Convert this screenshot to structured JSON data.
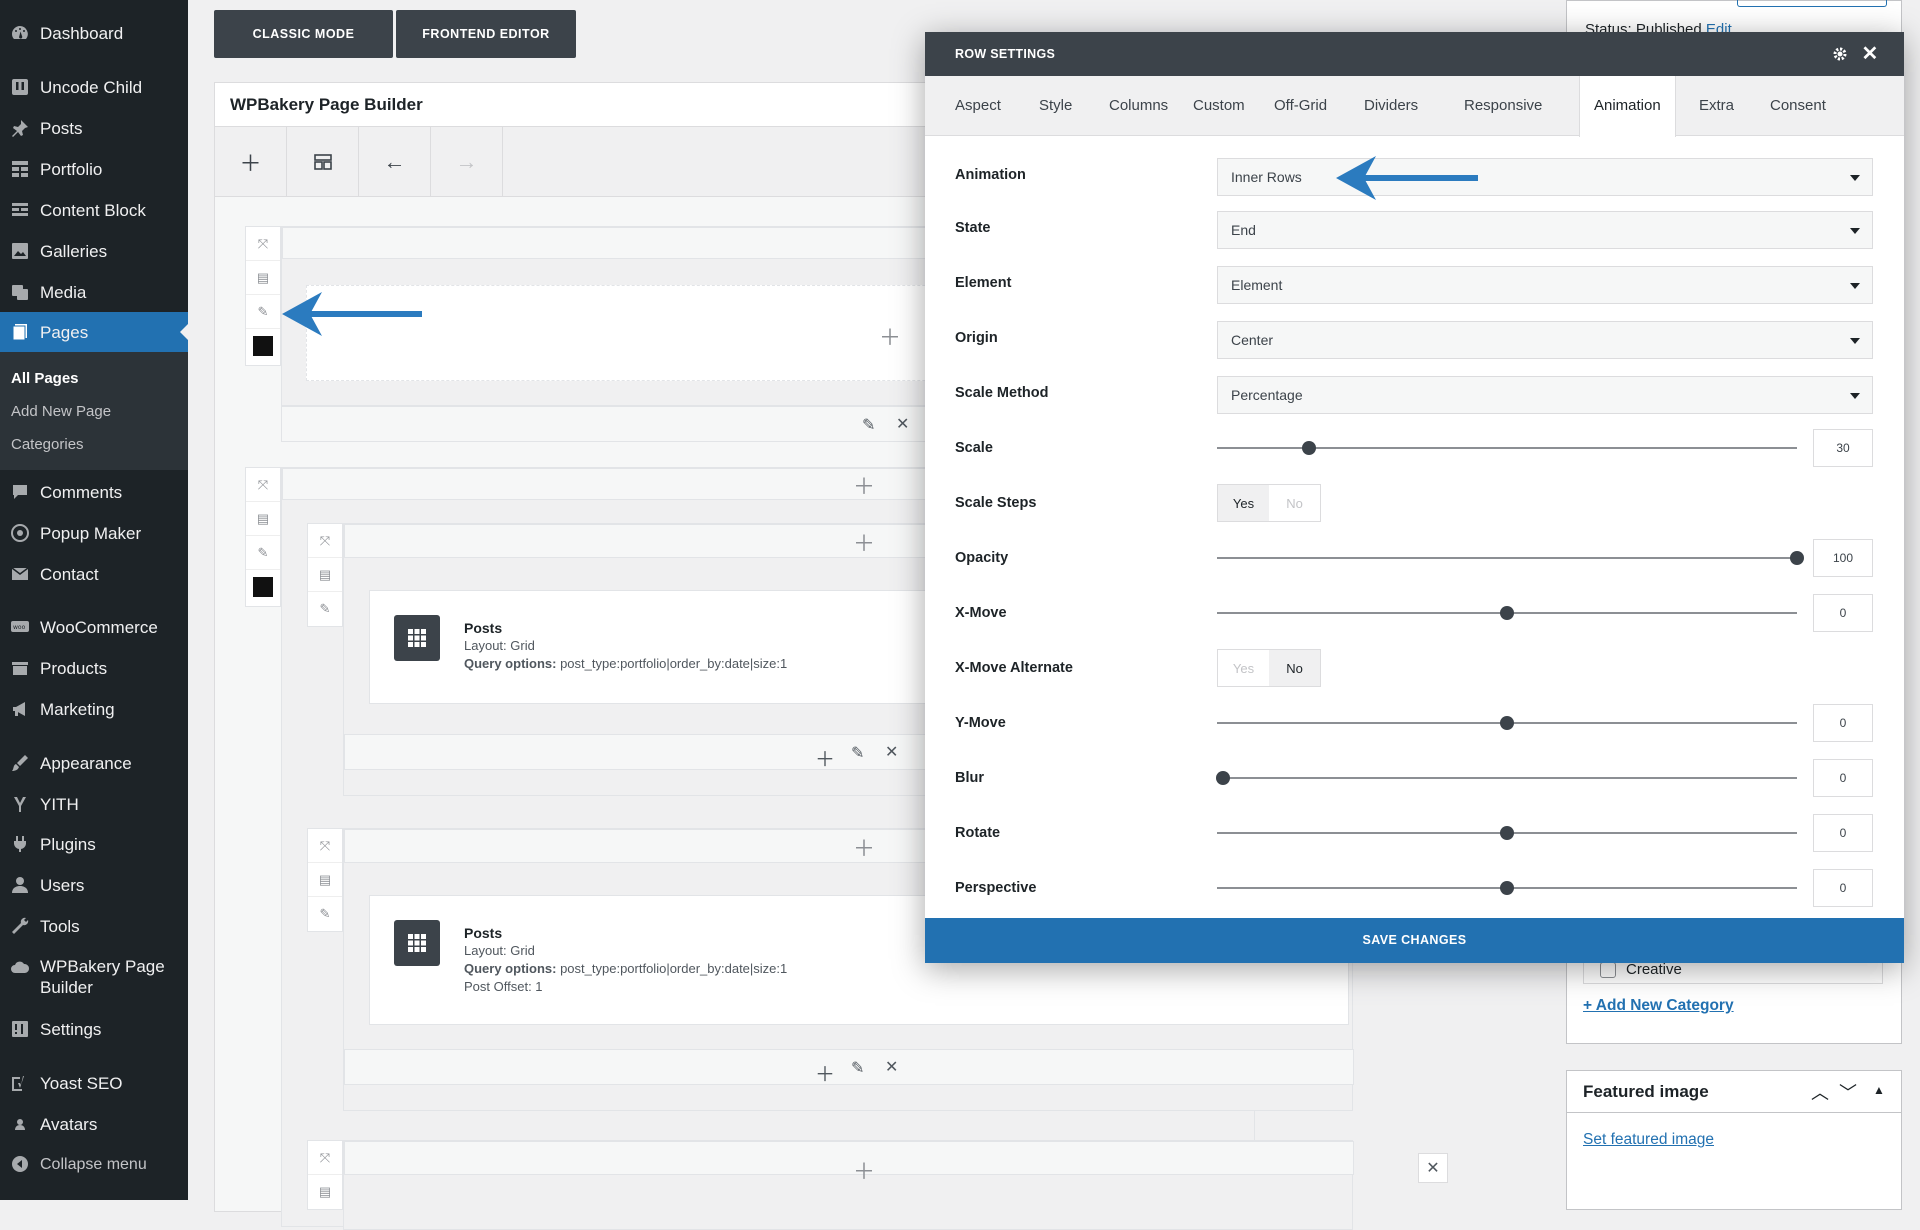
{
  "sidebar": {
    "items": [
      {
        "label": "Dashboard",
        "icon": "dashboard-icon"
      },
      {
        "label": "Uncode Child",
        "icon": "uncode-icon"
      },
      {
        "label": "Posts",
        "icon": "pin-icon"
      },
      {
        "label": "Portfolio",
        "icon": "portfolio-icon"
      },
      {
        "label": "Content Block",
        "icon": "content-block-icon"
      },
      {
        "label": "Galleries",
        "icon": "galleries-icon"
      },
      {
        "label": "Media",
        "icon": "media-icon"
      },
      {
        "label": "Pages",
        "icon": "pages-icon",
        "active": true
      },
      {
        "label": "Comments",
        "icon": "comments-icon"
      },
      {
        "label": "Popup Maker",
        "icon": "popup-icon"
      },
      {
        "label": "Contact",
        "icon": "mail-icon"
      },
      {
        "label": "WooCommerce",
        "icon": "woo-icon"
      },
      {
        "label": "Products",
        "icon": "products-icon"
      },
      {
        "label": "Marketing",
        "icon": "megaphone-icon"
      },
      {
        "label": "Appearance",
        "icon": "brush-icon"
      },
      {
        "label": "YITH",
        "icon": "yith-icon"
      },
      {
        "label": "Plugins",
        "icon": "plug-icon"
      },
      {
        "label": "Users",
        "icon": "user-icon"
      },
      {
        "label": "Tools",
        "icon": "wrench-icon"
      },
      {
        "label": "WPBakery Page Builder",
        "icon": "cloud-icon"
      },
      {
        "label": "Settings",
        "icon": "settings-icon"
      },
      {
        "label": "Yoast SEO",
        "icon": "yoast-icon"
      },
      {
        "label": "Avatars",
        "icon": "avatar-icon"
      },
      {
        "label": "Collapse menu",
        "icon": "collapse-icon"
      }
    ],
    "submenu": [
      "All Pages",
      "Add New Page",
      "Categories"
    ]
  },
  "editor": {
    "classic_mode": "CLASSIC MODE",
    "frontend_editor": "FRONTEND EDITOR",
    "builder_title": "WPBakery Page Builder",
    "elements": [
      {
        "title": "Posts",
        "layout_label": "Layout:",
        "layout": "Grid",
        "query_label": "Query options:",
        "query": "post_type:portfolio|order_by:date|size:1"
      },
      {
        "title": "Posts",
        "layout_label": "Layout:",
        "layout": "Grid",
        "query_label": "Query options:",
        "query": "post_type:portfolio|order_by:date|size:1",
        "offset": "Post Offset: 1"
      }
    ]
  },
  "metabox": {
    "status": "Status: Published",
    "status_edit": "Edit",
    "category_item": "Creative",
    "add_category": "+ Add New Category",
    "featured_title": "Featured image",
    "set_featured": "Set featured image"
  },
  "modal": {
    "title": "ROW SETTINGS",
    "tabs": [
      "Aspect",
      "Style",
      "Columns",
      "Custom",
      "Off-Grid",
      "Dividers",
      "Responsive",
      "Animation",
      "Extra",
      "Consent"
    ],
    "active_tab": "Animation",
    "fields": {
      "animation": {
        "label": "Animation",
        "value": "Inner Rows"
      },
      "state": {
        "label": "State",
        "value": "End"
      },
      "element": {
        "label": "Element",
        "value": "Element"
      },
      "origin": {
        "label": "Origin",
        "value": "Center"
      },
      "scale_method": {
        "label": "Scale Method",
        "value": "Percentage"
      },
      "scale": {
        "label": "Scale",
        "value": "30"
      },
      "scale_steps": {
        "label": "Scale Steps",
        "yes": "Yes",
        "no": "No",
        "selected": "Yes"
      },
      "opacity": {
        "label": "Opacity",
        "value": "100"
      },
      "x_move": {
        "label": "X-Move",
        "value": "0"
      },
      "x_move_alternate": {
        "label": "X-Move Alternate",
        "yes": "Yes",
        "no": "No",
        "selected": "No"
      },
      "y_move": {
        "label": "Y-Move",
        "value": "0"
      },
      "blur": {
        "label": "Blur",
        "value": "0"
      },
      "rotate": {
        "label": "Rotate",
        "value": "0"
      },
      "perspective": {
        "label": "Perspective",
        "value": "0"
      }
    },
    "save": "SAVE CHANGES"
  },
  "colors": {
    "sidebar_bg": "#1d2327",
    "accent": "#2271b1",
    "modal_head": "#3c434a",
    "annotation_arrow": "#2b7bbf"
  }
}
